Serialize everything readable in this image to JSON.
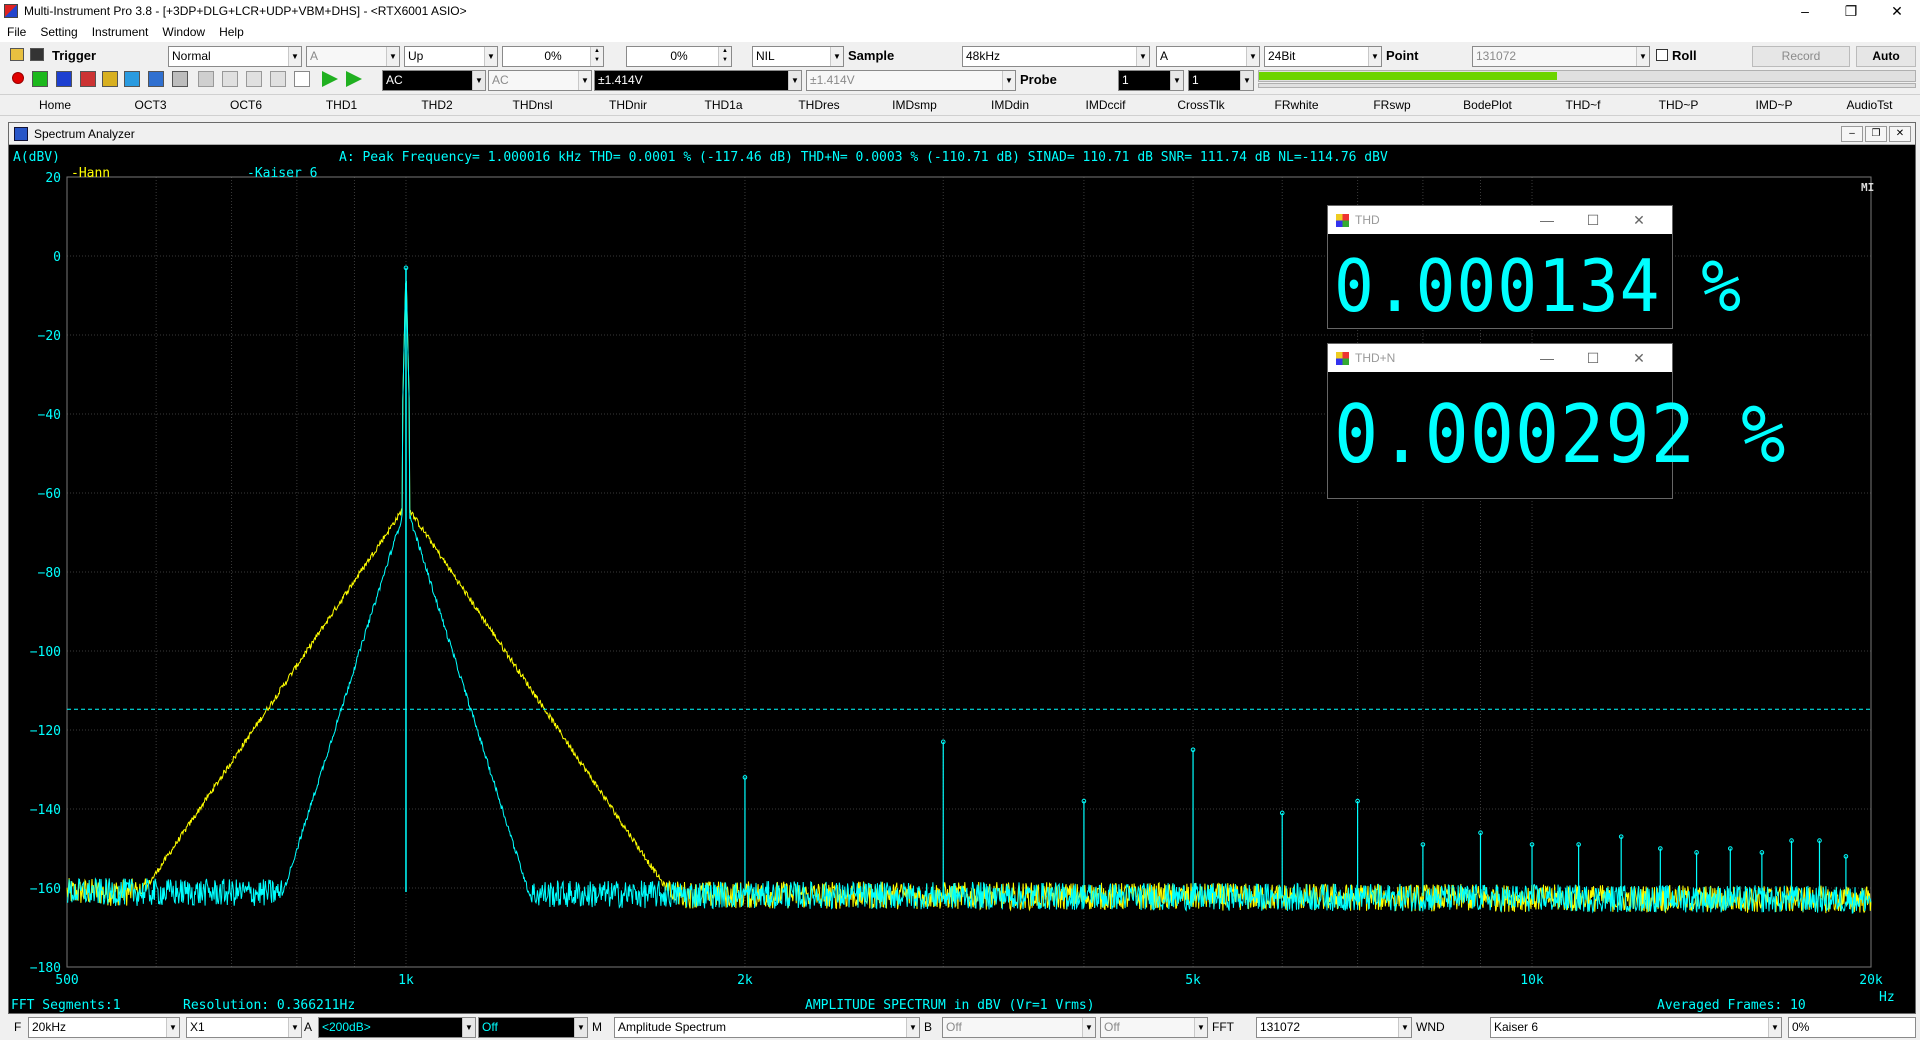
{
  "window": {
    "title": "Multi-Instrument Pro 3.8  -  [+3DP+DLG+LCR+UDP+VBM+DHS]  -  <RTX6001 ASIO>",
    "controls": [
      "–",
      "❐",
      "✕"
    ]
  },
  "menu": [
    "File",
    "Setting",
    "Instrument",
    "Window",
    "Help"
  ],
  "toolbar1": {
    "trigger_label": "Trigger",
    "mode": "Normal",
    "channel": "A",
    "edge": "Up",
    "level1": "0%",
    "level2": "0%",
    "nil": "NIL",
    "sample_label": "Sample",
    "sample_rate": "48kHz",
    "channel2": "A",
    "bits": "24Bit",
    "point_label": "Point",
    "points": "131072",
    "roll_label": "Roll",
    "record_label": "Record",
    "auto_label": "Auto"
  },
  "toolbar2": {
    "coupling_a": "AC",
    "coupling_b": "AC",
    "range_a": "±1.414V",
    "range_b": "±1.414V",
    "probe_label": "Probe",
    "probe_a": "1",
    "probe_b": "1",
    "level_meter": 0.455
  },
  "tabs": [
    "Home",
    "OCT3",
    "OCT6",
    "THD1",
    "THD2",
    "THDnsl",
    "THDnir",
    "THD1a",
    "THDres",
    "IMDsmp",
    "IMDdin",
    "IMDccif",
    "CrossTlk",
    "FRwhite",
    "FRswp",
    "BodePlot",
    "THD~f",
    "THD~P",
    "IMD~P",
    "AudioTst"
  ],
  "spectrum_window": {
    "title": "Spectrum Analyzer",
    "controls": [
      "–",
      "❐",
      "✕"
    ],
    "ylabel": "A(dBV)",
    "measure_line": "A: Peak Frequency= 1.000016 kHz  THD=  0.0001 % (-117.46 dB)  THD+N=  0.0003 % (-110.71 dB)  SINAD= 110.71 dB  SNR= 111.74 dB  NL=-114.76 dBV",
    "legend_hann": "-Hann",
    "legend_kaiser": "-Kaiser 6",
    "mi_badge": "MI",
    "fft_segments": "FFT Segments:1",
    "resolution": "Resolution: 0.366211Hz",
    "footer_title": "AMPLITUDE SPECTRUM in dBV (Vr=1 Vrms)",
    "averaged": "Averaged Frames: 10",
    "x_unit": "Hz"
  },
  "chart_data": {
    "type": "line",
    "title": "",
    "xlabel": "",
    "ylabel": "A(dBV)",
    "x_scale": "log",
    "xlim": [
      500,
      20000
    ],
    "ylim": [
      -180,
      20
    ],
    "yticks": [
      20,
      0,
      -20,
      -40,
      -60,
      -80,
      -100,
      -120,
      -140,
      -160,
      -180
    ],
    "ytick_labels": [
      "20",
      "0",
      "−20",
      "−40",
      "−60",
      "−80",
      "−100",
      "−120",
      "−140",
      "−160",
      "−180"
    ],
    "xticks": [
      500,
      1000,
      2000,
      5000,
      10000,
      20000
    ],
    "xtick_labels": [
      "500",
      "1k",
      "2k",
      "5k",
      "10k",
      "20k"
    ],
    "noise_level_dbv": -114.76,
    "noise_floor_dbv": -161,
    "series": [
      {
        "name": "Hann",
        "color": "#ffff00",
        "peak_hz": 1000,
        "peak_dbv": -3,
        "skirt": "wide"
      },
      {
        "name": "Kaiser 6",
        "color": "#00ffff",
        "peak_hz": 1000,
        "peak_dbv": -3,
        "skirt": "narrow"
      }
    ],
    "harmonics": [
      {
        "hz": 2000,
        "dbv": -132
      },
      {
        "hz": 3000,
        "dbv": -123
      },
      {
        "hz": 4000,
        "dbv": -138
      },
      {
        "hz": 5000,
        "dbv": -125
      },
      {
        "hz": 6000,
        "dbv": -141
      },
      {
        "hz": 7000,
        "dbv": -138
      },
      {
        "hz": 8000,
        "dbv": -149
      },
      {
        "hz": 9000,
        "dbv": -146
      },
      {
        "hz": 10000,
        "dbv": -149
      },
      {
        "hz": 11000,
        "dbv": -149
      },
      {
        "hz": 12000,
        "dbv": -147
      },
      {
        "hz": 13000,
        "dbv": -150
      },
      {
        "hz": 14000,
        "dbv": -151
      },
      {
        "hz": 15000,
        "dbv": -150
      },
      {
        "hz": 16000,
        "dbv": -151
      },
      {
        "hz": 17000,
        "dbv": -148
      },
      {
        "hz": 18000,
        "dbv": -148
      },
      {
        "hz": 19000,
        "dbv": -152
      }
    ],
    "colors": {
      "background": "#000000",
      "grid": "#3a3a3a",
      "text": "#00ffff",
      "hann": "#ffff00",
      "kaiser": "#00ffff"
    }
  },
  "meters": {
    "thd": {
      "name": "THD",
      "value": "0.000134 %",
      "controls": [
        "—",
        "☐",
        "✕"
      ]
    },
    "thdn": {
      "name": "THD+N",
      "value": "0.000292 %",
      "controls": [
        "—",
        "☐",
        "✕"
      ]
    }
  },
  "statusbar": {
    "f_label": "F",
    "f_value": "20kHz",
    "x_value": "X1",
    "a_label": "A",
    "a_value": "<200dB>",
    "a_off": "Off",
    "m_label": "M",
    "m_value": "Amplitude Spectrum",
    "b_label": "B",
    "b_off1": "Off",
    "b_off2": "Off",
    "fft_label": "FFT",
    "fft_value": "131072",
    "wnd_label": "WND",
    "wnd_value": "Kaiser 6",
    "pct": "0%"
  }
}
